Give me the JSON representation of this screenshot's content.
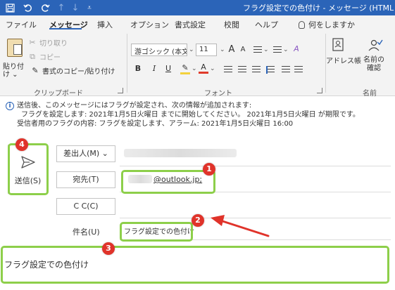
{
  "titlebar": {
    "title": "フラグ設定での色付け - メッセージ (HTML 形",
    "save_icon": "save-icon",
    "undo_icon": "undo-icon",
    "redo_icon": "redo-icon",
    "up_icon": "arrow-up-icon",
    "down_icon": "arrow-down-icon",
    "customize_icon": "customize-qat-icon"
  },
  "ribbon_tabs": [
    "ファイル",
    "メッセージ",
    "挿入",
    "オプション",
    "書式設定",
    "校閲",
    "ヘルプ",
    "何をしますか"
  ],
  "clipboard": {
    "paste": "貼り付け",
    "cut": "切り取り",
    "copy": "コピー",
    "format_painter": "書式のコピー/貼り付け",
    "group_label": "クリップボード"
  },
  "font": {
    "font_name": "游ゴシック (本文(",
    "font_size": "11",
    "grow": "A",
    "shrink": "A",
    "bold": "B",
    "italic": "I",
    "underline": "U",
    "font_color": "A",
    "group_label": "フォント"
  },
  "names": {
    "address_book": "アドレス帳",
    "check_names": "名前の\n確認",
    "group_label": "名前"
  },
  "info": {
    "line1": "送信後、このメッセージにはフラグが設定され、次の情報が追加されます:",
    "line2": "フラグを設定します: 2021年1月5日火曜日 までに開始してください。 2021年1月5日火曜日 が期限です。",
    "line3": "受信者用のフラグの内容: フラグを設定します、アラーム: 2021年1月5日火曜日 16:00"
  },
  "compose": {
    "send_label": "送信(S)",
    "from_label": "差出人(M)",
    "to_label": "宛先(T)",
    "cc_label": "C C(C)",
    "subject_label": "件名(U)",
    "to_value": "@outlook.jp;",
    "subject_value": "フラグ設定での色付け",
    "body_text": "フラグ設定での色付け"
  },
  "badges": [
    "1",
    "2",
    "3",
    "4"
  ],
  "colors": {
    "title_bar": "#2b64b8",
    "highlight": "#8dcf4a",
    "badge": "#e0332a"
  }
}
